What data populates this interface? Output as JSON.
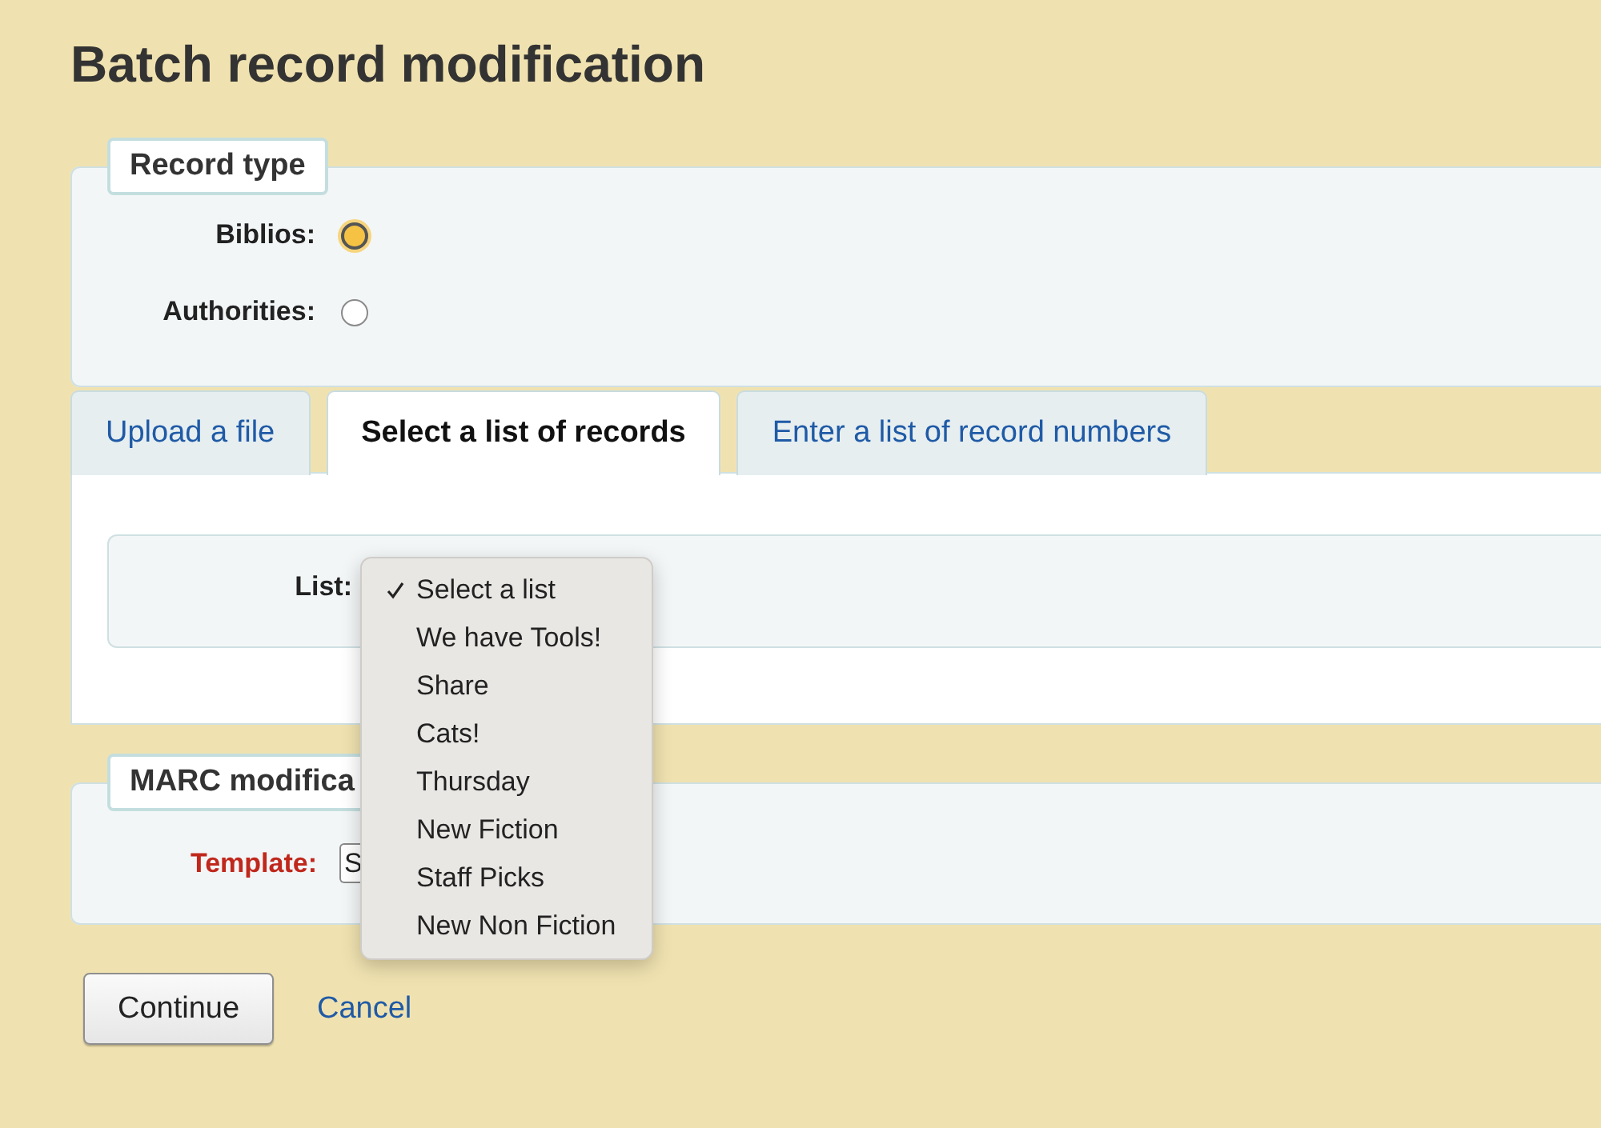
{
  "title": "Batch record modification",
  "record_type": {
    "legend": "Record type",
    "options": [
      {
        "label": "Biblios:",
        "selected": true
      },
      {
        "label": "Authorities:",
        "selected": false
      }
    ]
  },
  "tabs": [
    {
      "label": "Upload a file",
      "selected": false
    },
    {
      "label": "Select a list of records",
      "selected": true
    },
    {
      "label": "Enter a list of record numbers",
      "selected": false
    }
  ],
  "list_field": {
    "label": "List:"
  },
  "list_menu": {
    "items": [
      {
        "label": "Select a list",
        "checked": true
      },
      {
        "label": "We have Tools!",
        "checked": false
      },
      {
        "label": "Share",
        "checked": false
      },
      {
        "label": "Cats!",
        "checked": false
      },
      {
        "label": "Thursday",
        "checked": false
      },
      {
        "label": "New Fiction",
        "checked": false
      },
      {
        "label": "Staff Picks",
        "checked": false
      },
      {
        "label": "New Non Fiction",
        "checked": false
      }
    ]
  },
  "marc": {
    "legend": "MARC modifica",
    "template_label": "Template:",
    "template_value": "S"
  },
  "actions": {
    "continue": "Continue",
    "cancel": "Cancel"
  }
}
